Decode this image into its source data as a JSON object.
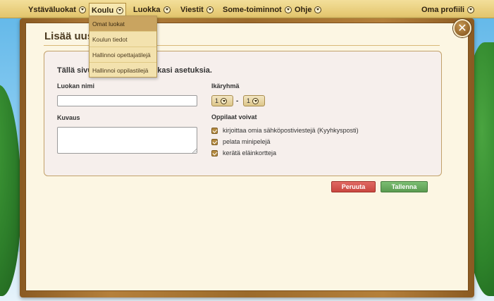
{
  "nav": {
    "items": [
      {
        "label": "Ystäväluokat"
      },
      {
        "label": "Koulu"
      },
      {
        "label": "Luokka"
      },
      {
        "label": "Viestit"
      },
      {
        "label": "Some-toiminnot"
      },
      {
        "label": "Ohje"
      }
    ],
    "profile_label": "Oma profiili",
    "active": "Koulu"
  },
  "dropdown": {
    "items": [
      {
        "label": "Omat luokat"
      },
      {
        "label": "Koulun tiedot"
      },
      {
        "label": "Hallinnoi opettajatilejä"
      },
      {
        "label": "Hallinnoi oppilastilejä"
      }
    ],
    "highlighted": "Omat luokat"
  },
  "dialog": {
    "title_visible": "Lisää uusi",
    "intro_visible": "Tällä sivu",
    "intro_visible_tail": "kkasi asetuksia.",
    "class_name_label": "Luokan nimi",
    "class_name_value": "",
    "description_label": "Kuvaus",
    "description_value": "",
    "age_group_label": "Ikäryhmä",
    "age_from": "1",
    "age_to": "1",
    "age_separator": "-",
    "students_can_label": "Oppilaat voivat",
    "permissions": [
      {
        "label": "kirjoittaa omia sähköpostiviestejä (Kyyhkysposti)",
        "checked": true
      },
      {
        "label": "pelata minipelejä",
        "checked": true
      },
      {
        "label": "kerätä eläinkortteja",
        "checked": true
      }
    ],
    "cancel_label": "Peruuta",
    "save_label": "Tallenna",
    "close_icon": "close-icon"
  },
  "colors": {
    "nav_bg": "#e2c46b",
    "frame": "#9b6a2b",
    "panel_bg": "#fcf6e3",
    "cancel": "#c9473f",
    "save": "#5a9b50"
  }
}
